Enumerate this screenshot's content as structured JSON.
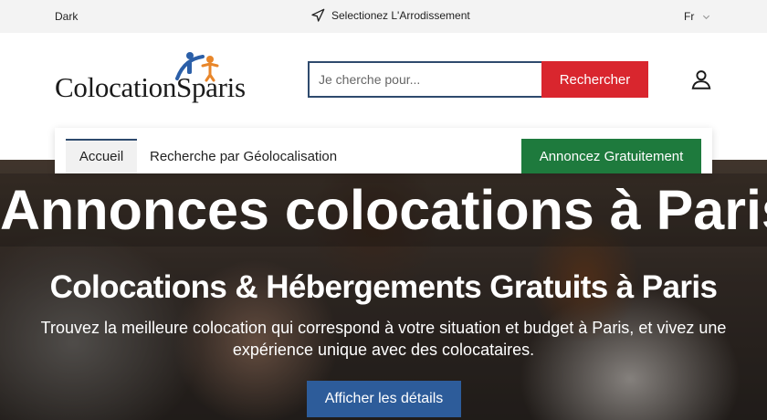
{
  "topbar": {
    "theme_label": "Dark",
    "arrondissement_label": "Selectionez L'Arrodissement",
    "arrondissement_icon": "navigation-arrow-icon",
    "language": "Fr",
    "language_icon": "chevron-down-icon"
  },
  "header": {
    "logo_text": "ColocationSparis",
    "search": {
      "placeholder": "Je cherche pour...",
      "value": "",
      "button_label": "Rechercher"
    },
    "user_icon": "user-icon"
  },
  "nav": {
    "items": [
      {
        "label": "Accueil",
        "active": true
      },
      {
        "label": "Recherche par Géolocalisation",
        "active": false
      }
    ],
    "cta_label": "Annoncez Gratuitement"
  },
  "hero": {
    "title": "Annonces colocations à Paris",
    "subtitle": "Colocations & Hébergements Gratuits à Paris",
    "description": "Trouvez la meilleure colocation qui correspond à votre situation et budget à Paris, et vivez une expérience unique avec des colocataires.",
    "button_label": "Afficher les détails"
  },
  "colors": {
    "search_button": "#d9262e",
    "cta_button": "#1e7a3d",
    "hero_button": "#2d5c9a",
    "logo_blue": "#2b5fa8",
    "logo_orange": "#e8862a"
  }
}
